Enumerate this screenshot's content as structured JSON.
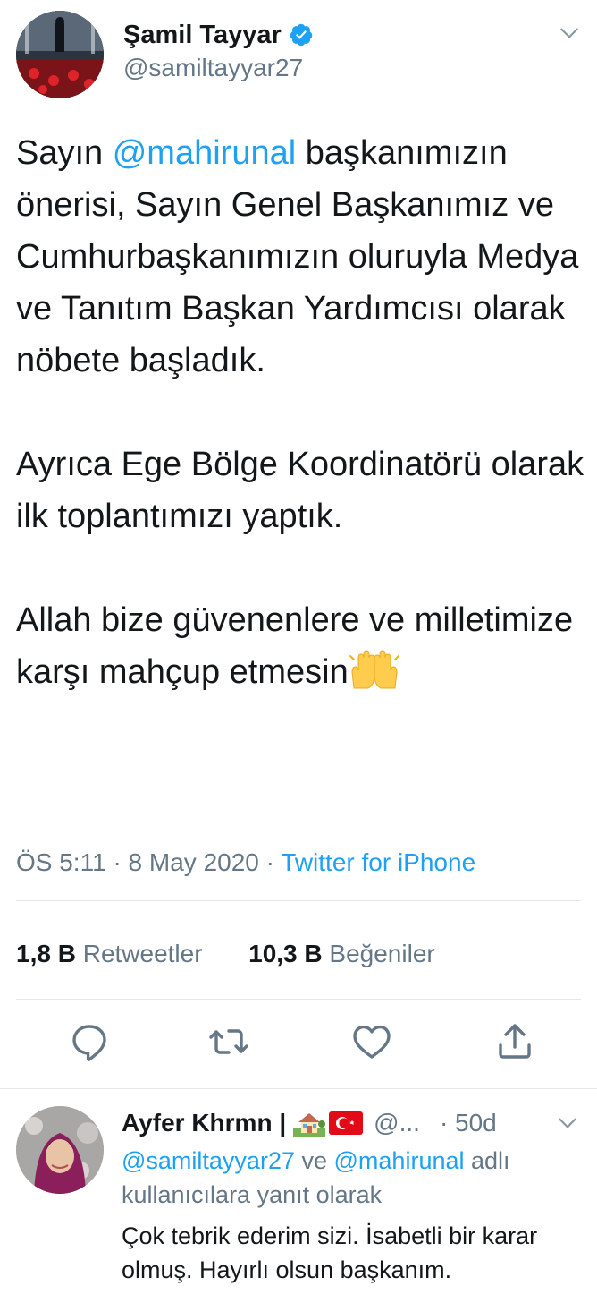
{
  "tweet": {
    "author_name": "Şamil Tayyar",
    "author_handle": "@samiltayyar27",
    "text_prefix": "Sayın ",
    "mention": "@mahirunal",
    "text_p1_rest": " başkanımızın önerisi, Sayın Genel Başkanımız ve Cumhurbaşkanımızın oluruyla Medya ve Tanıtım Başkan Yardımcısı olarak nöbete başladık.",
    "text_p2": "Ayrıca Ege Bölge Koordinatörü olarak ilk toplantımızı yaptık.",
    "text_p3": "Allah bize güvenenlere ve milletimize karşı mahçup etmesin",
    "time": "ÖS 5:11",
    "date": "8 May 2020",
    "source": "Twitter for iPhone",
    "retweets_count": "1,8 B",
    "retweets_label": "Retweetler",
    "likes_count": "10,3 B",
    "likes_label": "Beğeniler"
  },
  "reply": {
    "author_name": "Ayfer Khrmn |",
    "handle": "@...",
    "time": "· 50d",
    "reply_to_mention_1": "@samiltayyar27",
    "reply_to_connector": " ve ",
    "reply_to_mention_2": "@mahirunal",
    "reply_to_suffix": " adlı kullanıcılara yanıt olarak",
    "text": "Çok tebrik ederim sizi. İsabetli bir karar olmuş. Hayırlı olsun başkanım."
  },
  "icons": {
    "verified": "verified-badge-icon",
    "chevron": "chevron-down-icon",
    "reply": "reply-icon",
    "retweet": "retweet-icon",
    "like": "heart-icon",
    "share": "share-icon",
    "raised_hands": "raised-hands-emoji",
    "house": "house-emoji",
    "flag": "turkey-flag-emoji"
  },
  "colors": {
    "accent": "#1da1f2",
    "text": "#14171a",
    "secondary": "#657786",
    "divider": "#e1e8ed"
  }
}
